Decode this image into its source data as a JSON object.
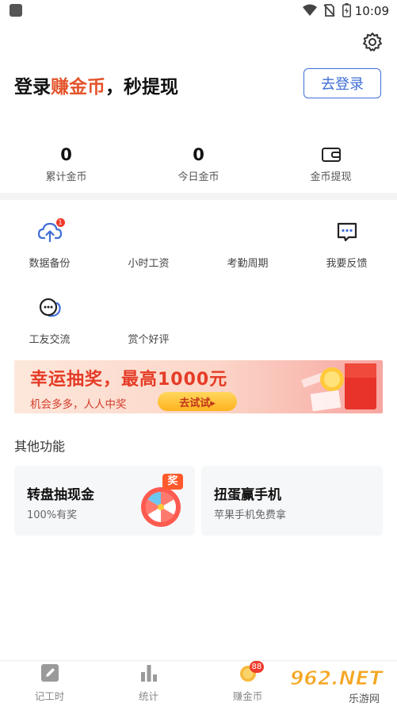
{
  "status_bar": {
    "time": "10:09"
  },
  "hero": {
    "title_prefix": "登录",
    "title_highlight": "赚金币",
    "title_suffix": "，秒提现",
    "login_button": "去登录"
  },
  "stats": [
    {
      "value": "0",
      "label": "累计金币"
    },
    {
      "value": "0",
      "label": "今日金币"
    },
    {
      "value": "",
      "label": "金币提现"
    }
  ],
  "grid": [
    {
      "label": "数据备份",
      "icon": "cloud-upload-icon",
      "badge": "1"
    },
    {
      "label": "小时工资",
      "icon": "",
      "badge": ""
    },
    {
      "label": "考勤周期",
      "icon": "",
      "badge": ""
    },
    {
      "label": "我要反馈",
      "icon": "feedback-chat-icon",
      "badge": ""
    },
    {
      "label": "工友交流",
      "icon": "chat-bubbles-icon",
      "badge": ""
    },
    {
      "label": "赏个好评",
      "icon": "",
      "badge": ""
    }
  ],
  "banner": {
    "title": "幸运抽奖，最高1000元",
    "subtitle": "机会多多，人人中奖",
    "button": "去试试▸"
  },
  "other": {
    "section_title": "其他功能",
    "cards": [
      {
        "title": "转盘抽现金",
        "subtitle": "100%有奖",
        "badge": "奖"
      },
      {
        "title": "扭蛋赢手机",
        "subtitle": "苹果手机免费拿"
      }
    ]
  },
  "tabs": [
    {
      "label": "记工时",
      "icon": "edit-icon"
    },
    {
      "label": "统计",
      "icon": "bar-chart-icon"
    },
    {
      "label": "赚金币",
      "icon": "coin-icon",
      "badge": "88"
    }
  ],
  "watermark": {
    "text": "962.NET",
    "subtext": "乐游网"
  },
  "colors": {
    "accent": "#3f6fd6",
    "highlight": "#e4542b",
    "badge": "#ef3b2c"
  }
}
